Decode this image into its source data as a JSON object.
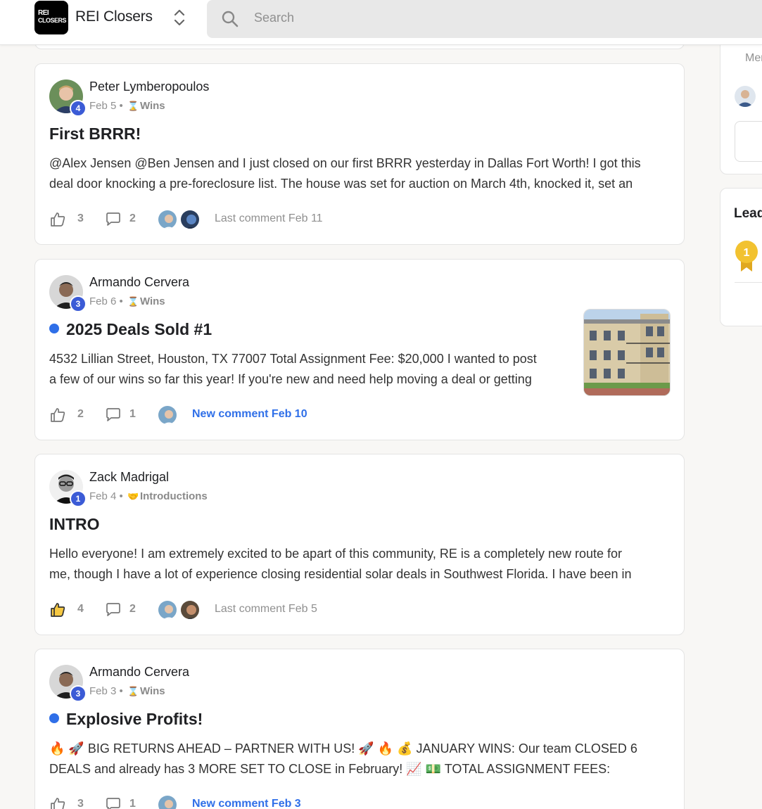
{
  "header": {
    "logo_line1": "REI",
    "logo_line2": "CLOSERS",
    "app_title": "REI Closers",
    "search_placeholder": "Search"
  },
  "sidebar": {
    "members_label": "Mer",
    "leaderboard_title": "Lead",
    "leader_rank": "1"
  },
  "posts": [
    {
      "author": "Peter Lymberopoulos",
      "level": "4",
      "date": "Feb 5",
      "category": "Wins",
      "category_icon": "hourglass-icon",
      "title": "First BRRR!",
      "unread": false,
      "excerpt_line1": "@Alex Jensen @Ben Jensen and I just closed on our first BRRR yesterday in Dallas Fort Worth! I got this",
      "excerpt_line2": "deal door knocking a pre-foreclosure list. The house was set for auction on March 4th, knocked it, set an",
      "likes": "3",
      "comments": "2",
      "last_comment": "Last comment Feb 11",
      "new_comment": false
    },
    {
      "author": "Armando Cervera",
      "level": "3",
      "date": "Feb 6",
      "category": "Wins",
      "category_icon": "hourglass-icon",
      "title": "2025 Deals Sold #1",
      "unread": true,
      "excerpt_line1": "4532 Lillian Street, Houston, TX 77007 Total Assignment Fee: $20,000 I wanted to post",
      "excerpt_line2": "a few of our wins so far this year! If you're new and need help moving a deal or getting",
      "likes": "2",
      "comments": "1",
      "last_comment": "New comment Feb 10",
      "new_comment": true
    },
    {
      "author": "Zack Madrigal",
      "level": "1",
      "date": "Feb 4",
      "category": "Introductions",
      "category_icon": "handshake-icon",
      "title": "INTRO",
      "unread": false,
      "excerpt_line1": "Hello everyone! I am extremely excited to be apart of this community, RE is a completely new route for",
      "excerpt_line2": "me, though I have a lot of experience closing residential solar deals in Southwest Florida. I have been in",
      "likes": "4",
      "comments": "2",
      "last_comment": "Last comment Feb 5",
      "new_comment": false
    },
    {
      "author": "Armando Cervera",
      "level": "3",
      "date": "Feb 3",
      "category": "Wins",
      "category_icon": "hourglass-icon",
      "title": "Explosive Profits!",
      "unread": true,
      "excerpt_line1": "🔥 🚀 BIG RETURNS AHEAD – PARTNER WITH US! 🚀 🔥 💰 JANUARY WINS: Our team CLOSED 6",
      "excerpt_line2": "DEALS and already has 3 MORE SET TO CLOSE in February! 📈 💵 TOTAL ASSIGNMENT FEES:",
      "likes": "3",
      "comments": "1",
      "last_comment": "New comment Feb 3",
      "new_comment": true
    }
  ],
  "colors": {
    "accent_blue": "#2f6fe8",
    "level_badge": "#3b5bd6",
    "muted": "#909090",
    "medal_gold": "#f2c230"
  }
}
